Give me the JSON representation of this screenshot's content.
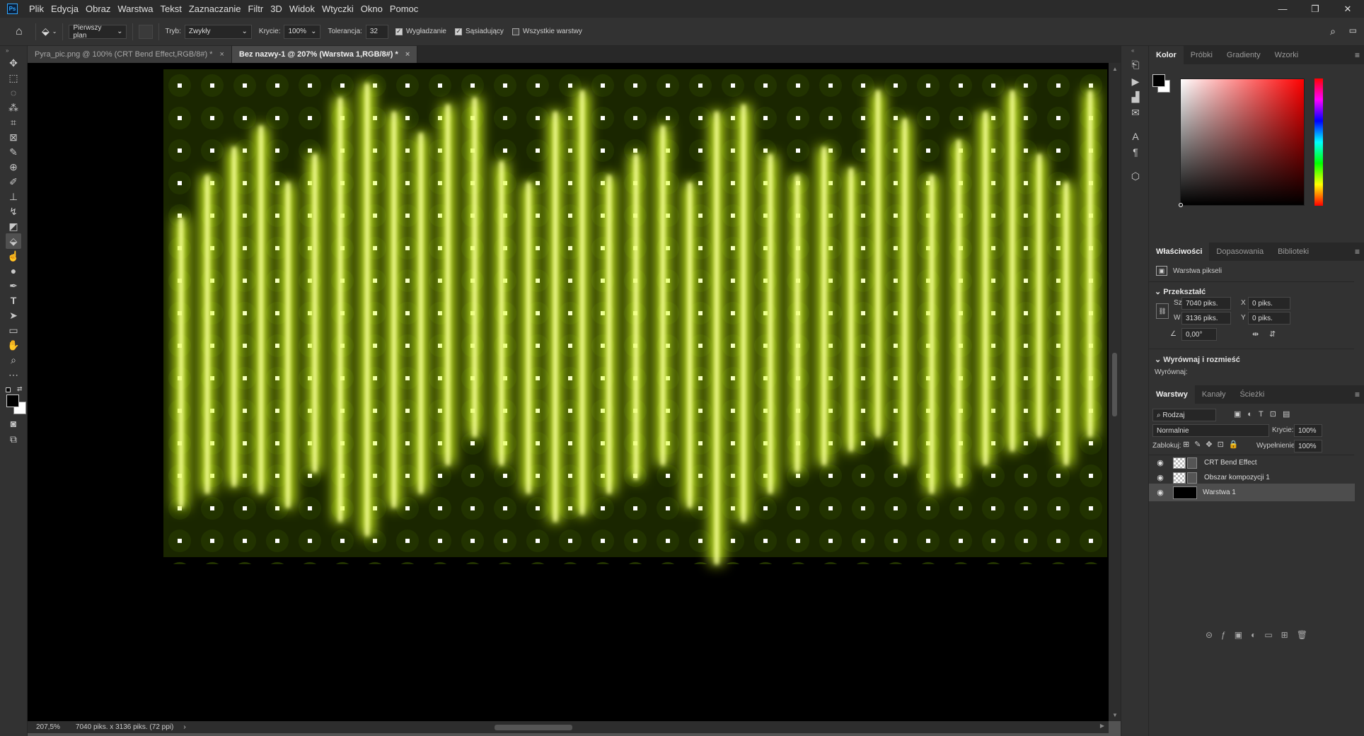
{
  "menubar": {
    "logo": "Ps",
    "items": [
      "Plik",
      "Edycja",
      "Obraz",
      "Warstwa",
      "Tekst",
      "Zaznaczanie",
      "Filtr",
      "3D",
      "Widok",
      "Wtyczki",
      "Okno",
      "Pomoc"
    ],
    "minimize": "—",
    "restore": "❐",
    "close": "✕"
  },
  "options": {
    "fill_source": "Pierwszy plan",
    "mode_label": "Tryb:",
    "mode_value": "Zwykły",
    "opacity_label": "Krycie:",
    "opacity_value": "100%",
    "tolerance_label": "Tolerancja:",
    "tolerance_value": "32",
    "antialias_label": "Wygładzanie",
    "contiguous_label": "Sąsiadujący",
    "all_layers_label": "Wszystkie warstwy"
  },
  "tabs": [
    {
      "label": "Pyra_pic.png @ 100% (CRT Bend Effect,RGB/8#) *",
      "close": "×"
    },
    {
      "label": "Bez nazwy-1 @ 207% (Warstwa 1,RGB/8#) *",
      "close": "×"
    }
  ],
  "status": {
    "zoom": "207,5%",
    "doc_size": "7040 piks. x 3136 piks. (72 ppi)",
    "arrow": "›"
  },
  "colors": {
    "accent": "#31a8ff",
    "glow": "#d8ff1a",
    "glow_dark": "#1c2a00",
    "canvas_bg": "#000000",
    "panel_bg": "#323232"
  },
  "color_panel": {
    "tabs": [
      "Kolor",
      "Próbki",
      "Gradienty",
      "Wzorki"
    ],
    "active": "Kolor",
    "fg_color": "#000000",
    "bg_color": "#ffffff",
    "picker_hue": "#ff0000"
  },
  "properties_panel": {
    "tabs": [
      "Właściwości",
      "Dopasowania",
      "Biblioteki"
    ],
    "active": "Właściwości",
    "layer_type": "Warstwa pikseli",
    "transform_head": "Przekształć",
    "w_label": "Sz",
    "w_value": "7040 piks.",
    "h_label": "W",
    "h_value": "3136 piks.",
    "x_label": "X",
    "x_value": "0 piks.",
    "y_label": "Y",
    "y_value": "0 piks.",
    "angle_value": "0,00°",
    "align_head": "Wyrównaj i rozmieść",
    "align_label": "Wyrównaj:"
  },
  "layers_panel": {
    "tabs": [
      "Warstwy",
      "Kanały",
      "Ścieżki"
    ],
    "active": "Warstwy",
    "filter": "Rodzaj",
    "blend_mode": "Normalnie",
    "opacity_label": "Krycie:",
    "opacity_value": "100%",
    "lock_label": "Zablokuj:",
    "fill_label": "Wypełnienie:",
    "fill_value": "100%",
    "layers": [
      {
        "name": "CRT Bend Effect",
        "type": "smart"
      },
      {
        "name": "Obszar kompozycji 1",
        "type": "smart"
      },
      {
        "name": "Warstwa 1",
        "type": "pixel",
        "selected": true
      }
    ]
  },
  "tools": [
    "move-tool",
    "marquee-tool",
    "lasso-tool",
    "magic-wand-tool",
    "crop-tool",
    "frame-tool",
    "eyedropper-tool",
    "healing-brush-tool",
    "brush-tool",
    "clone-stamp-tool",
    "history-brush-tool",
    "eraser-tool",
    "paint-bucket-tool",
    "smudge-tool",
    "dodge-tool",
    "pen-tool",
    "type-tool",
    "path-selection-tool",
    "rectangle-tool",
    "hand-tool",
    "zoom-tool",
    "more-tools"
  ]
}
